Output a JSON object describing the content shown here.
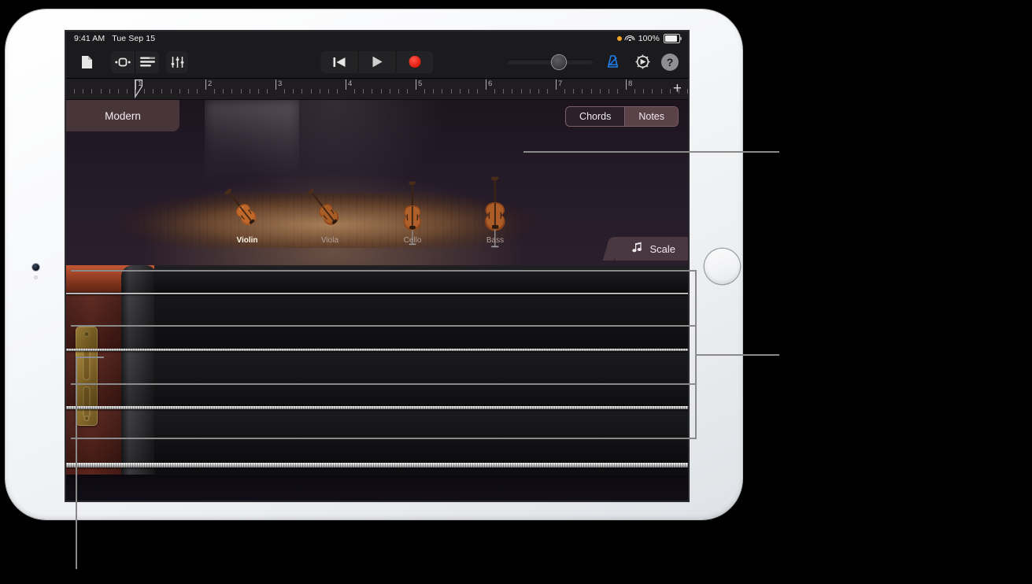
{
  "status_bar": {
    "time": "9:41 AM",
    "date": "Tue Sep 15",
    "battery_percent": "100%",
    "icons": [
      "mic-recording-dot",
      "wifi-icon",
      "battery-icon"
    ]
  },
  "toolbar": {
    "left_buttons": [
      {
        "name": "document-icon",
        "label": "My Songs"
      },
      {
        "name": "loop-browser-icon",
        "label": "Browser"
      },
      {
        "name": "track-view-icon",
        "label": "Tracks"
      },
      {
        "name": "mixer-fx-icon",
        "label": "FX"
      }
    ],
    "transport": [
      {
        "name": "rewind-icon",
        "label": "Rewind"
      },
      {
        "name": "play-icon",
        "label": "Play"
      },
      {
        "name": "record-icon",
        "label": "Record"
      }
    ],
    "master_volume": {
      "label": "Master Volume",
      "value": 62
    },
    "metronome": {
      "label": "Metronome",
      "color": "#1f7ce8"
    },
    "settings": {
      "label": "Settings",
      "name": "gear-icon"
    },
    "help": {
      "label": "?",
      "name": "help-icon"
    }
  },
  "ruler": {
    "bars": [
      "1",
      "2",
      "3",
      "4",
      "5",
      "6",
      "7",
      "8"
    ],
    "playhead_bar": "1",
    "add_button": "+"
  },
  "stage": {
    "preset_name": "Modern",
    "mode_tabs": [
      {
        "label": "Chords",
        "active": false
      },
      {
        "label": "Notes",
        "active": true
      }
    ],
    "scale_button": {
      "label": "Scale",
      "icon": "double-eighth-note-icon"
    },
    "instruments": [
      {
        "label": "Violin",
        "selected": true
      },
      {
        "label": "Viola",
        "selected": false
      },
      {
        "label": "Cello",
        "selected": false
      },
      {
        "label": "Bass",
        "selected": false
      }
    ]
  },
  "fingerboard": {
    "strings": [
      "string-1-e",
      "string-2-a",
      "string-3-d",
      "string-4-g"
    ],
    "position_markers": 4
  },
  "device": {
    "home_button": "Home",
    "front_camera": "front-camera"
  },
  "colors": {
    "accent_blue": "#1f7ce8",
    "record_red": "#e01b0e",
    "preset_brown": "#483539",
    "stage_purple": "#241a28"
  }
}
